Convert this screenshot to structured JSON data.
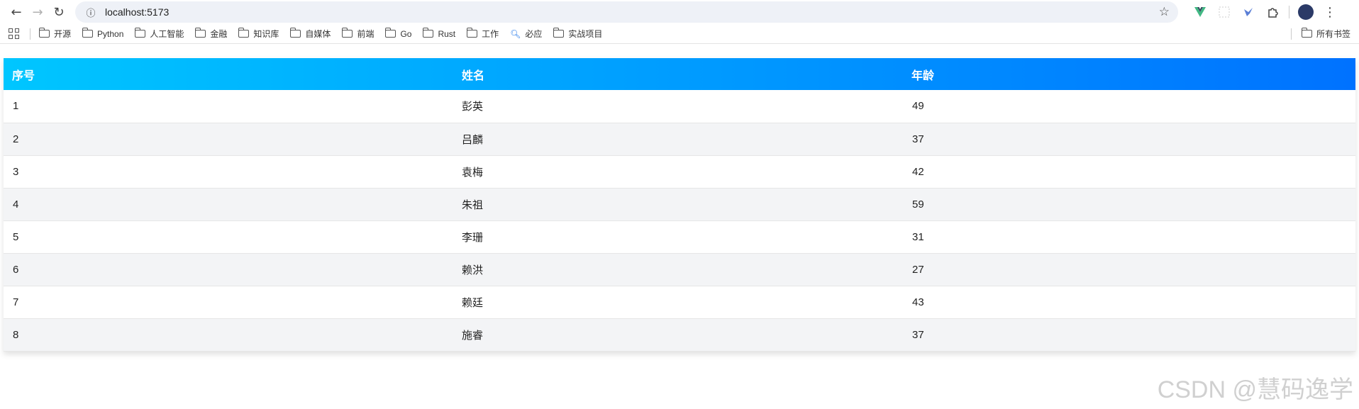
{
  "browser": {
    "url": "localhost:5173",
    "bookmarks": [
      "开源",
      "Python",
      "人工智能",
      "金融",
      "知识库",
      "自媒体",
      "前端",
      "Go",
      "Rust",
      "工作"
    ],
    "bookmark_search": "必应",
    "bookmark_last": "实战项目",
    "all_bookmarks": "所有书签"
  },
  "table": {
    "headers": {
      "index": "序号",
      "name": "姓名",
      "age": "年龄"
    },
    "rows": [
      {
        "index": "1",
        "name": "彭英",
        "age": "49"
      },
      {
        "index": "2",
        "name": "吕麟",
        "age": "37"
      },
      {
        "index": "3",
        "name": "袁梅",
        "age": "42"
      },
      {
        "index": "4",
        "name": "朱祖",
        "age": "59"
      },
      {
        "index": "5",
        "name": "李珊",
        "age": "31"
      },
      {
        "index": "6",
        "name": "赖洪",
        "age": "27"
      },
      {
        "index": "7",
        "name": "赖廷",
        "age": "43"
      },
      {
        "index": "8",
        "name": "施睿",
        "age": "37"
      }
    ],
    "header_gradient": [
      "#00c6ff",
      "#0072ff"
    ]
  },
  "watermark": "CSDN @慧码逸学"
}
